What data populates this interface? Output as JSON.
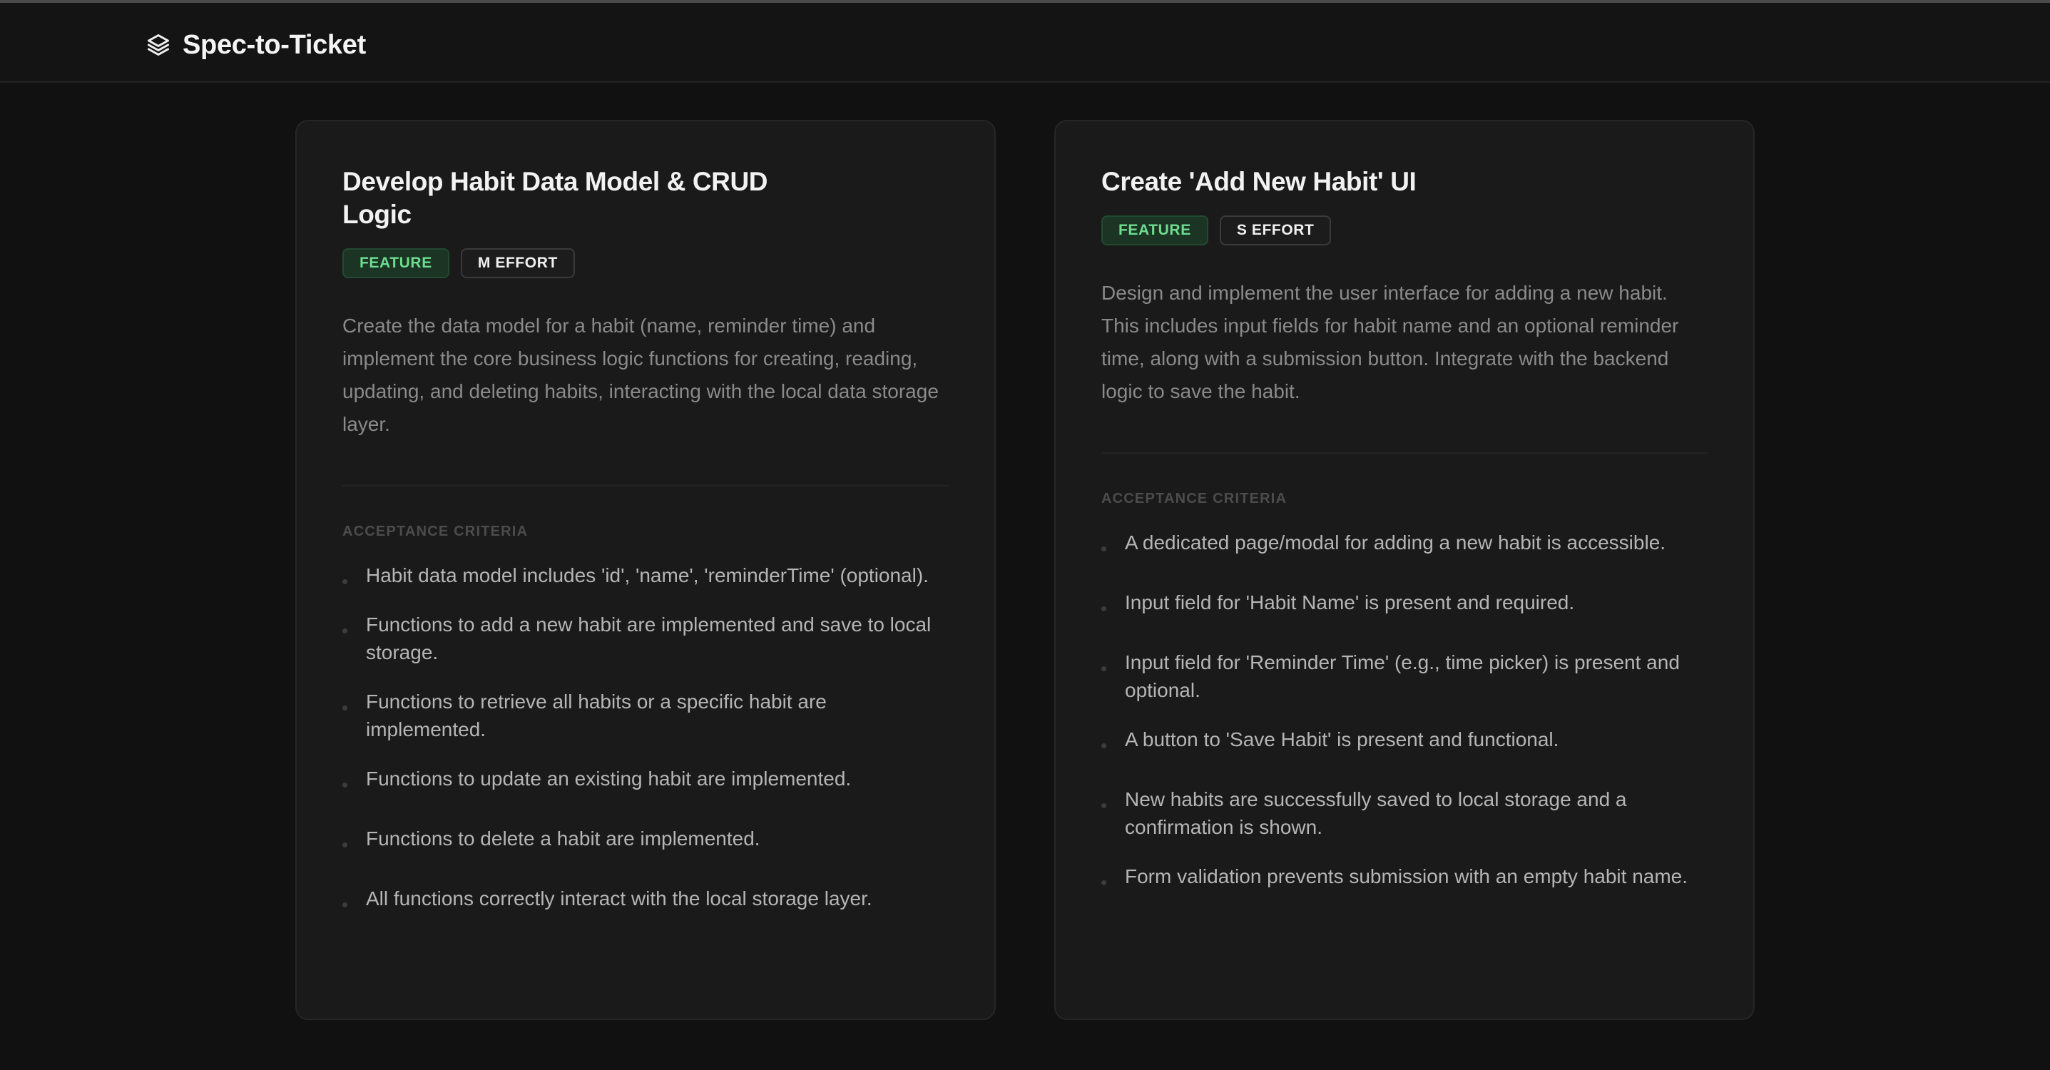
{
  "app": {
    "title": "Spec-to-Ticket",
    "icon": "layers-icon"
  },
  "colors": {
    "background": "#111111",
    "card": "#1a1a1a",
    "feature_badge_text": "#6ddd8f",
    "feature_badge_bg": "#1b3424"
  },
  "tickets": [
    {
      "title": "Develop Habit Data Model & CRUD Logic",
      "type_label": "FEATURE",
      "effort_label": "M EFFORT",
      "description": "Create the data model for a habit (name, reminder time) and implement the core business logic functions for creating, reading, updating, and deleting habits, interacting with the local data storage layer.",
      "criteria_heading": "ACCEPTANCE CRITERIA",
      "criteria": [
        "Habit data model includes 'id', 'name', 'reminderTime' (optional).",
        "Functions to add a new habit are implemented and save to local storage.",
        "Functions to retrieve all habits or a specific habit are implemented.",
        "Functions to update an existing habit are implemented.",
        "Functions to delete a habit are implemented.",
        "All functions correctly interact with the local storage layer."
      ]
    },
    {
      "title": "Create 'Add New Habit' UI",
      "type_label": "FEATURE",
      "effort_label": "S EFFORT",
      "description": "Design and implement the user interface for adding a new habit. This includes input fields for habit name and an optional reminder time, along with a submission button. Integrate with the backend logic to save the habit.",
      "criteria_heading": "ACCEPTANCE CRITERIA",
      "criteria": [
        "A dedicated page/modal for adding a new habit is accessible.",
        "Input field for 'Habit Name' is present and required.",
        "Input field for 'Reminder Time' (e.g., time picker) is present and optional.",
        "A button to 'Save Habit' is present and functional.",
        "New habits are successfully saved to local storage and a confirmation is shown.",
        "Form validation prevents submission with an empty habit name."
      ]
    }
  ]
}
